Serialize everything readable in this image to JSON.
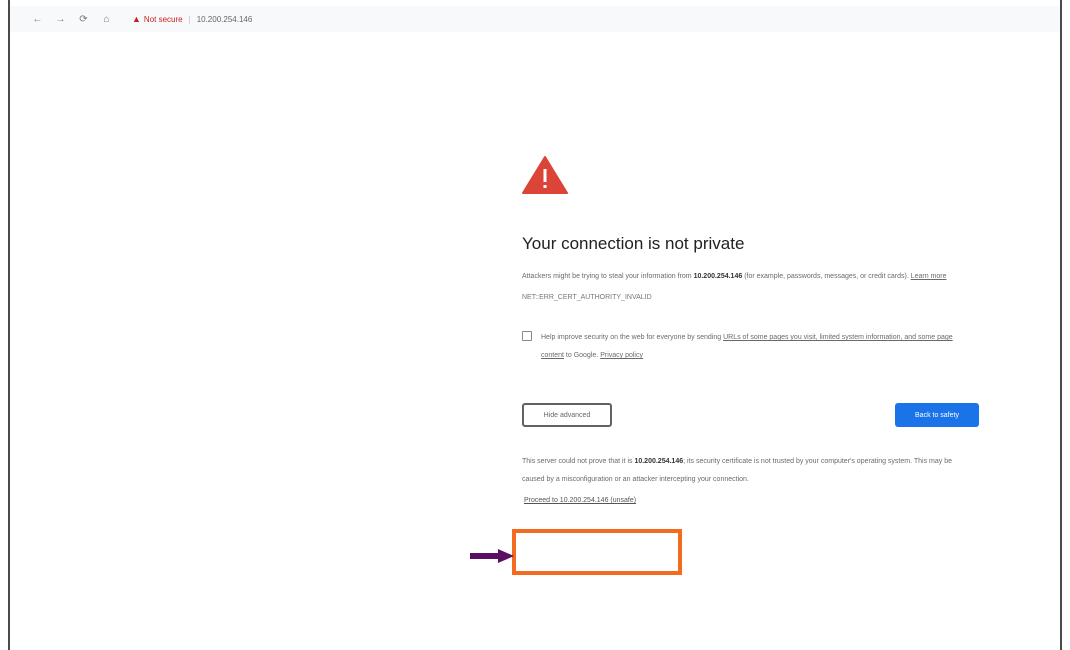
{
  "browser": {
    "back_glyph": "←",
    "forward_glyph": "→",
    "reload_glyph": "⟳",
    "home_glyph": "⌂",
    "security_label": "Not secure",
    "separator": "|",
    "address": "10.200.254.146"
  },
  "interstitial": {
    "title": "Your connection is not private",
    "para_prefix": "Attackers might be trying to steal your information from",
    "para_host": "10.200.254.146",
    "para_suffix": "(for example, passwords, messages, or credit cards).",
    "learn_more": "Learn more",
    "error_code": "NET::ERR_CERT_AUTHORITY_INVALID",
    "optin_prefix": "Help improve security on the web for everyone by sending",
    "optin_link1": "URLs of some pages you visit, limited system information, and some page content",
    "optin_middle": "to Google.",
    "optin_link2": "Privacy policy",
    "advanced_button": "Hide advanced",
    "back_button": "Back to safety",
    "details_prefix": "This server could not prove that it is",
    "details_host": "10.200.254.146",
    "details_suffix": "; its security certificate is not trusted by your computer's operating system. This may be caused by a misconfiguration or an attacker intercepting your connection.",
    "proceed_link": "Proceed to 10.200.254.146 (unsafe)"
  },
  "colors": {
    "warning_red": "#db4437",
    "primary_blue": "#1a73e8",
    "highlight_orange": "#f26b21",
    "arrow_purple": "#5b0f63"
  }
}
